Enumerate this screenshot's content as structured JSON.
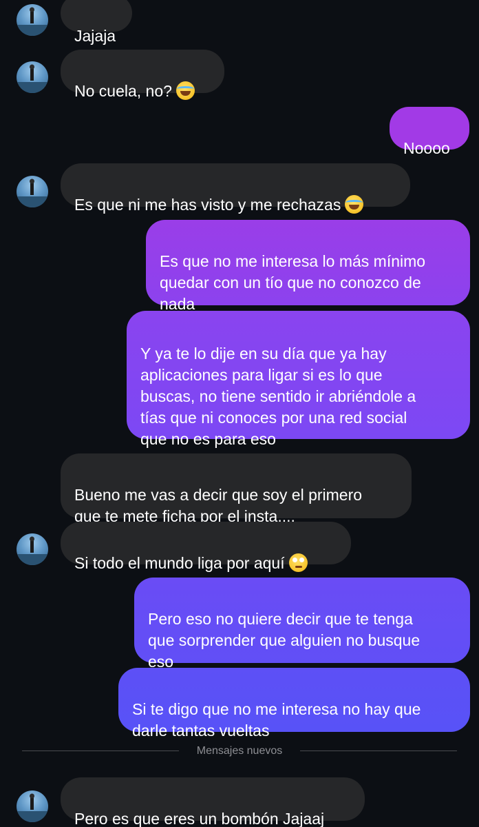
{
  "conversation": {
    "messages": [
      {
        "sender": "them",
        "text": "Jajaja"
      },
      {
        "sender": "them",
        "text": "No cuela, no?",
        "emoji": "face-with-tears-of-joy"
      },
      {
        "sender": "me",
        "text": "Noooo"
      },
      {
        "sender": "them",
        "text": "Es que ni me has visto y me rechazas",
        "emoji": "face-with-tears-of-joy"
      },
      {
        "sender": "me",
        "text": "Es que no me interesa lo más mínimo\nquedar con un tío que no conozco de\nnada"
      },
      {
        "sender": "me",
        "text": "Y ya te lo dije en su día que ya hay\naplicaciones para ligar si es lo que\nbuscas,  no tiene sentido ir abriéndole a\ntías que ni conoces por una red social\nque no es para eso"
      },
      {
        "sender": "them",
        "text": "Bueno me vas a decir que soy el primero\nque te mete ficha por el insta...."
      },
      {
        "sender": "them",
        "text": "Si todo el mundo liga por aquí",
        "emoji": "face-with-rolling-eyes"
      },
      {
        "sender": "me",
        "text": "Pero eso no quiere decir que te tenga\nque sorprender que alguien no busque\neso"
      },
      {
        "sender": "me",
        "text": "Si te digo que no me interesa no hay que\ndarle tantas vueltas"
      },
      {
        "sender": "them",
        "text": "Pero es que eres un bombón Jajaaj"
      }
    ],
    "new_messages_divider": "Mensajes nuevos"
  },
  "colors": {
    "background": "#0c0f14",
    "received_bubble": "#262729",
    "sent_gradient_top": "#a23ae6",
    "sent_gradient_bottom": "#5b4cf6",
    "text": "#ffffff",
    "divider_text": "#8e8f94"
  },
  "icons": {
    "avatar": "contact-avatar-photo",
    "emoji_laugh": "face-with-tears-of-joy",
    "emoji_eyeroll": "face-with-rolling-eyes"
  }
}
